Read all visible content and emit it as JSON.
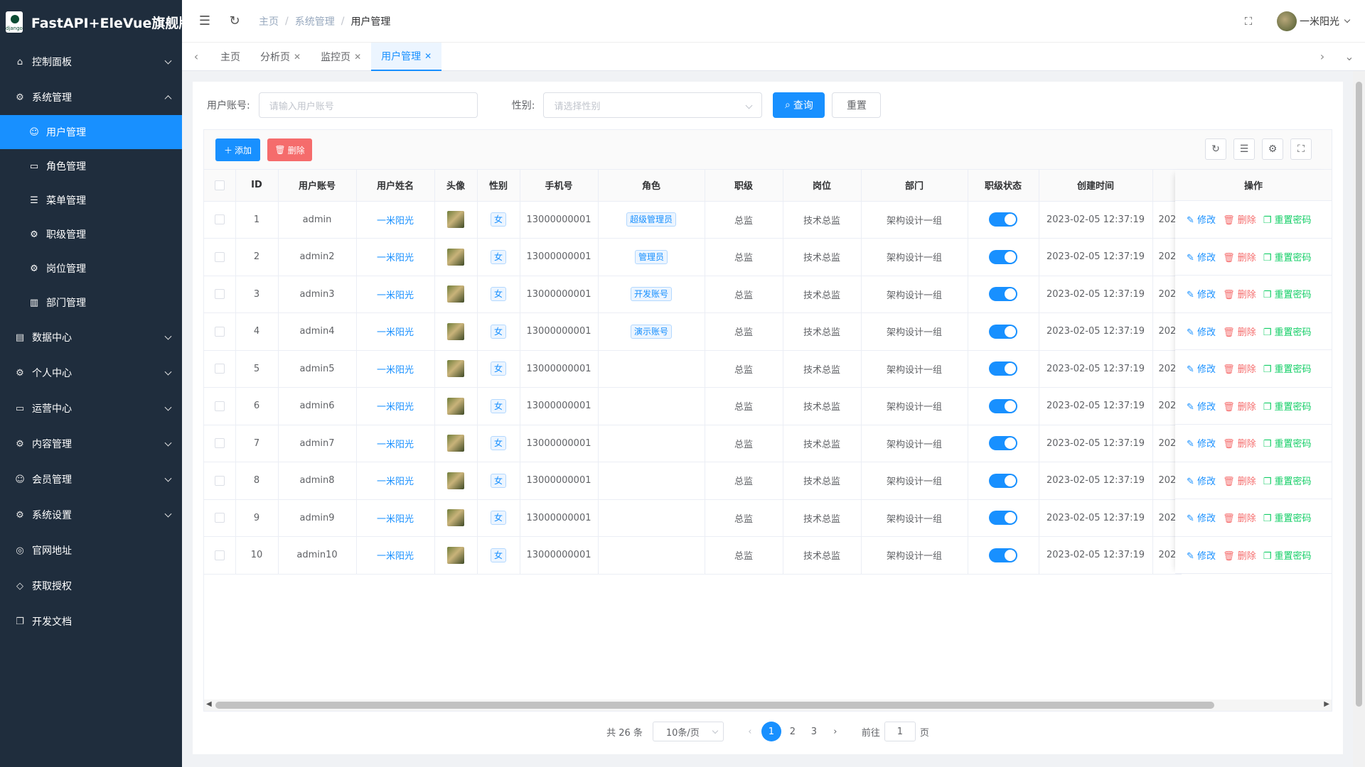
{
  "app": {
    "title": "FastAPI+EleVue旗舰版",
    "logo_text": "django"
  },
  "sidebar": {
    "items": [
      {
        "label": "控制面板",
        "icon": "home-icon"
      },
      {
        "label": "系统管理",
        "icon": "gear-icon"
      },
      {
        "label": "数据中心",
        "icon": "database-icon"
      },
      {
        "label": "个人中心",
        "icon": "gears-icon"
      },
      {
        "label": "运营中心",
        "icon": "card-icon"
      },
      {
        "label": "内容管理",
        "icon": "gears-icon"
      },
      {
        "label": "会员管理",
        "icon": "user-icon"
      },
      {
        "label": "系统设置",
        "icon": "gears-icon"
      },
      {
        "label": "官网地址",
        "icon": "globe-icon"
      },
      {
        "label": "获取授权",
        "icon": "diamond-icon"
      },
      {
        "label": "开发文档",
        "icon": "copy-icon"
      }
    ],
    "sub_items": [
      {
        "label": "用户管理",
        "icon": "user-icon",
        "active": true
      },
      {
        "label": "角色管理",
        "icon": "id-card-icon"
      },
      {
        "label": "菜单管理",
        "icon": "sliders-icon"
      },
      {
        "label": "职级管理",
        "icon": "gear-icon"
      },
      {
        "label": "岗位管理",
        "icon": "gear-icon"
      },
      {
        "label": "部门管理",
        "icon": "building-icon"
      }
    ]
  },
  "header": {
    "breadcrumb": [
      "主页",
      "系统管理",
      "用户管理"
    ],
    "username": "一米阳光"
  },
  "tabs": [
    {
      "label": "主页",
      "closable": false
    },
    {
      "label": "分析页",
      "closable": true
    },
    {
      "label": "监控页",
      "closable": true
    },
    {
      "label": "用户管理",
      "closable": true,
      "active": true
    }
  ],
  "search": {
    "account_label": "用户账号:",
    "account_placeholder": "请输入用户账号",
    "gender_label": "性别:",
    "gender_placeholder": "请选择性别",
    "query_button": "查询",
    "reset_button": "重置"
  },
  "toolbar": {
    "add_label": "添加",
    "delete_label": "删除"
  },
  "table": {
    "columns": [
      "ID",
      "用户账号",
      "用户姓名",
      "头像",
      "性别",
      "手机号",
      "角色",
      "职级",
      "岗位",
      "部门",
      "职级状态",
      "创建时间",
      "",
      "操作"
    ],
    "op_labels": {
      "edit": "修改",
      "delete": "删除",
      "reset": "重置密码"
    },
    "rows": [
      {
        "id": "1",
        "account": "admin",
        "name": "一米阳光",
        "gender": "女",
        "phone": "13000000001",
        "role": "超级管理员",
        "level": "总监",
        "position": "技术总监",
        "dept": "架构设计一组",
        "created": "2023-02-05 12:37:19",
        "extra": "202"
      },
      {
        "id": "2",
        "account": "admin2",
        "name": "一米阳光",
        "gender": "女",
        "phone": "13000000001",
        "role": "管理员",
        "level": "总监",
        "position": "技术总监",
        "dept": "架构设计一组",
        "created": "2023-02-05 12:37:19",
        "extra": "202"
      },
      {
        "id": "3",
        "account": "admin3",
        "name": "一米阳光",
        "gender": "女",
        "phone": "13000000001",
        "role": "开发账号",
        "level": "总监",
        "position": "技术总监",
        "dept": "架构设计一组",
        "created": "2023-02-05 12:37:19",
        "extra": "202"
      },
      {
        "id": "4",
        "account": "admin4",
        "name": "一米阳光",
        "gender": "女",
        "phone": "13000000001",
        "role": "演示账号",
        "level": "总监",
        "position": "技术总监",
        "dept": "架构设计一组",
        "created": "2023-02-05 12:37:19",
        "extra": "202"
      },
      {
        "id": "5",
        "account": "admin5",
        "name": "一米阳光",
        "gender": "女",
        "phone": "13000000001",
        "role": "",
        "level": "总监",
        "position": "技术总监",
        "dept": "架构设计一组",
        "created": "2023-02-05 12:37:19",
        "extra": "202"
      },
      {
        "id": "6",
        "account": "admin6",
        "name": "一米阳光",
        "gender": "女",
        "phone": "13000000001",
        "role": "",
        "level": "总监",
        "position": "技术总监",
        "dept": "架构设计一组",
        "created": "2023-02-05 12:37:19",
        "extra": "202"
      },
      {
        "id": "7",
        "account": "admin7",
        "name": "一米阳光",
        "gender": "女",
        "phone": "13000000001",
        "role": "",
        "level": "总监",
        "position": "技术总监",
        "dept": "架构设计一组",
        "created": "2023-02-05 12:37:19",
        "extra": "202"
      },
      {
        "id": "8",
        "account": "admin8",
        "name": "一米阳光",
        "gender": "女",
        "phone": "13000000001",
        "role": "",
        "level": "总监",
        "position": "技术总监",
        "dept": "架构设计一组",
        "created": "2023-02-05 12:37:19",
        "extra": "202"
      },
      {
        "id": "9",
        "account": "admin9",
        "name": "一米阳光",
        "gender": "女",
        "phone": "13000000001",
        "role": "",
        "level": "总监",
        "position": "技术总监",
        "dept": "架构设计一组",
        "created": "2023-02-05 12:37:19",
        "extra": "202"
      },
      {
        "id": "10",
        "account": "admin10",
        "name": "一米阳光",
        "gender": "女",
        "phone": "13000000001",
        "role": "",
        "level": "总监",
        "position": "技术总监",
        "dept": "架构设计一组",
        "created": "2023-02-05 12:37:19",
        "extra": "202"
      }
    ]
  },
  "pagination": {
    "total": "共 26 条",
    "page_size": "10条/页",
    "pages": [
      "1",
      "2",
      "3"
    ],
    "current": "1",
    "goto_label": "前往",
    "goto_value": "1",
    "page_suffix": "页"
  },
  "colors": {
    "accent": "#1890ff",
    "sidebar_bg": "#1f2d3d",
    "danger": "#f56c6c",
    "success": "#13ce66"
  }
}
